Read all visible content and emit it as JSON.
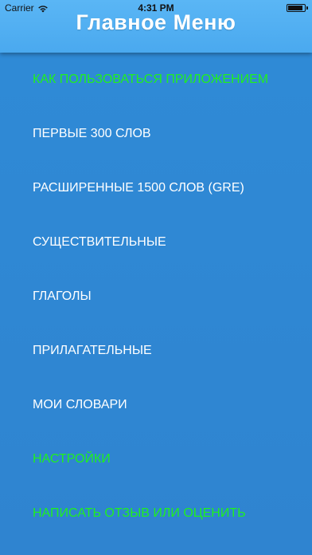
{
  "status_bar": {
    "carrier": "Carrier",
    "time": "4:31 PM",
    "wifi_icon": "wifi-icon",
    "battery_icon": "battery-icon",
    "battery_level": 0.9
  },
  "header": {
    "title": "Главное Меню"
  },
  "colors": {
    "header_bg": "#4aa9ef",
    "menu_bg": "#2f87d4",
    "item_text": "#ffffff",
    "item_text_highlight": "#1ff01f"
  },
  "menu": {
    "items": [
      {
        "label": "КАК ПОЛЬЗОВАТЬСЯ ПРИЛОЖЕНИЕМ",
        "highlight": true
      },
      {
        "label": "ПЕРВЫЕ 300 СЛОВ",
        "highlight": false
      },
      {
        "label": "РАСШИРЕННЫЕ 1500 СЛОВ (GRE)",
        "highlight": false
      },
      {
        "label": "СУЩЕСТВИТЕЛЬНЫЕ",
        "highlight": false
      },
      {
        "label": "ГЛАГОЛЫ",
        "highlight": false
      },
      {
        "label": "ПРИЛАГАТЕЛЬНЫЕ",
        "highlight": false
      },
      {
        "label": "МОИ СЛОВАРИ",
        "highlight": false
      },
      {
        "label": "НАСТРОЙКИ",
        "highlight": true
      },
      {
        "label": "НАПИСАТЬ ОТЗЫВ ИЛИ ОЦЕНИТЬ",
        "highlight": true
      }
    ]
  }
}
